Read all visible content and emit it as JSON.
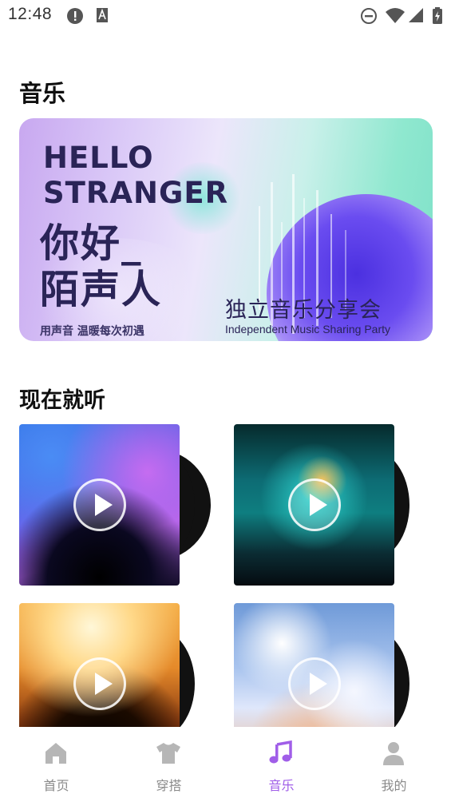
{
  "status_bar": {
    "time": "12:48",
    "icons": [
      "alert-circle-icon",
      "font-icon",
      "dnd-icon",
      "wifi-icon",
      "signal-icon",
      "battery-charging-icon"
    ]
  },
  "music_section": {
    "title": "音乐"
  },
  "banner": {
    "headline_line1": "HELLO",
    "headline_line2": "STRANGER",
    "cn_line1": "你好_",
    "cn_line2": "陌声人",
    "tagline": "用声音 温暖每次初遇",
    "event_title": "独立音乐分享会",
    "event_subtitle": "Independent Music Sharing Party"
  },
  "listen_now": {
    "title": "现在就听",
    "cards": [
      {
        "cover": "concert-confetti",
        "play_icon": "play-icon"
      },
      {
        "cover": "concert-stage-teal",
        "play_icon": "play-icon"
      },
      {
        "cover": "concert-stage-orange",
        "play_icon": "play-icon"
      },
      {
        "cover": "cello-clouds",
        "play_icon": "play-icon"
      }
    ]
  },
  "bottom_nav": {
    "items": [
      {
        "label": "首页",
        "icon": "home-icon",
        "active": false
      },
      {
        "label": "穿搭",
        "icon": "tshirt-icon",
        "active": false
      },
      {
        "label": "音乐",
        "icon": "music-note-icon",
        "active": true
      },
      {
        "label": "我的",
        "icon": "user-icon",
        "active": false
      }
    ]
  },
  "colors": {
    "accent": "#a05ee8",
    "inactive": "#b6b6b6",
    "disc_center": "#f0265a"
  }
}
